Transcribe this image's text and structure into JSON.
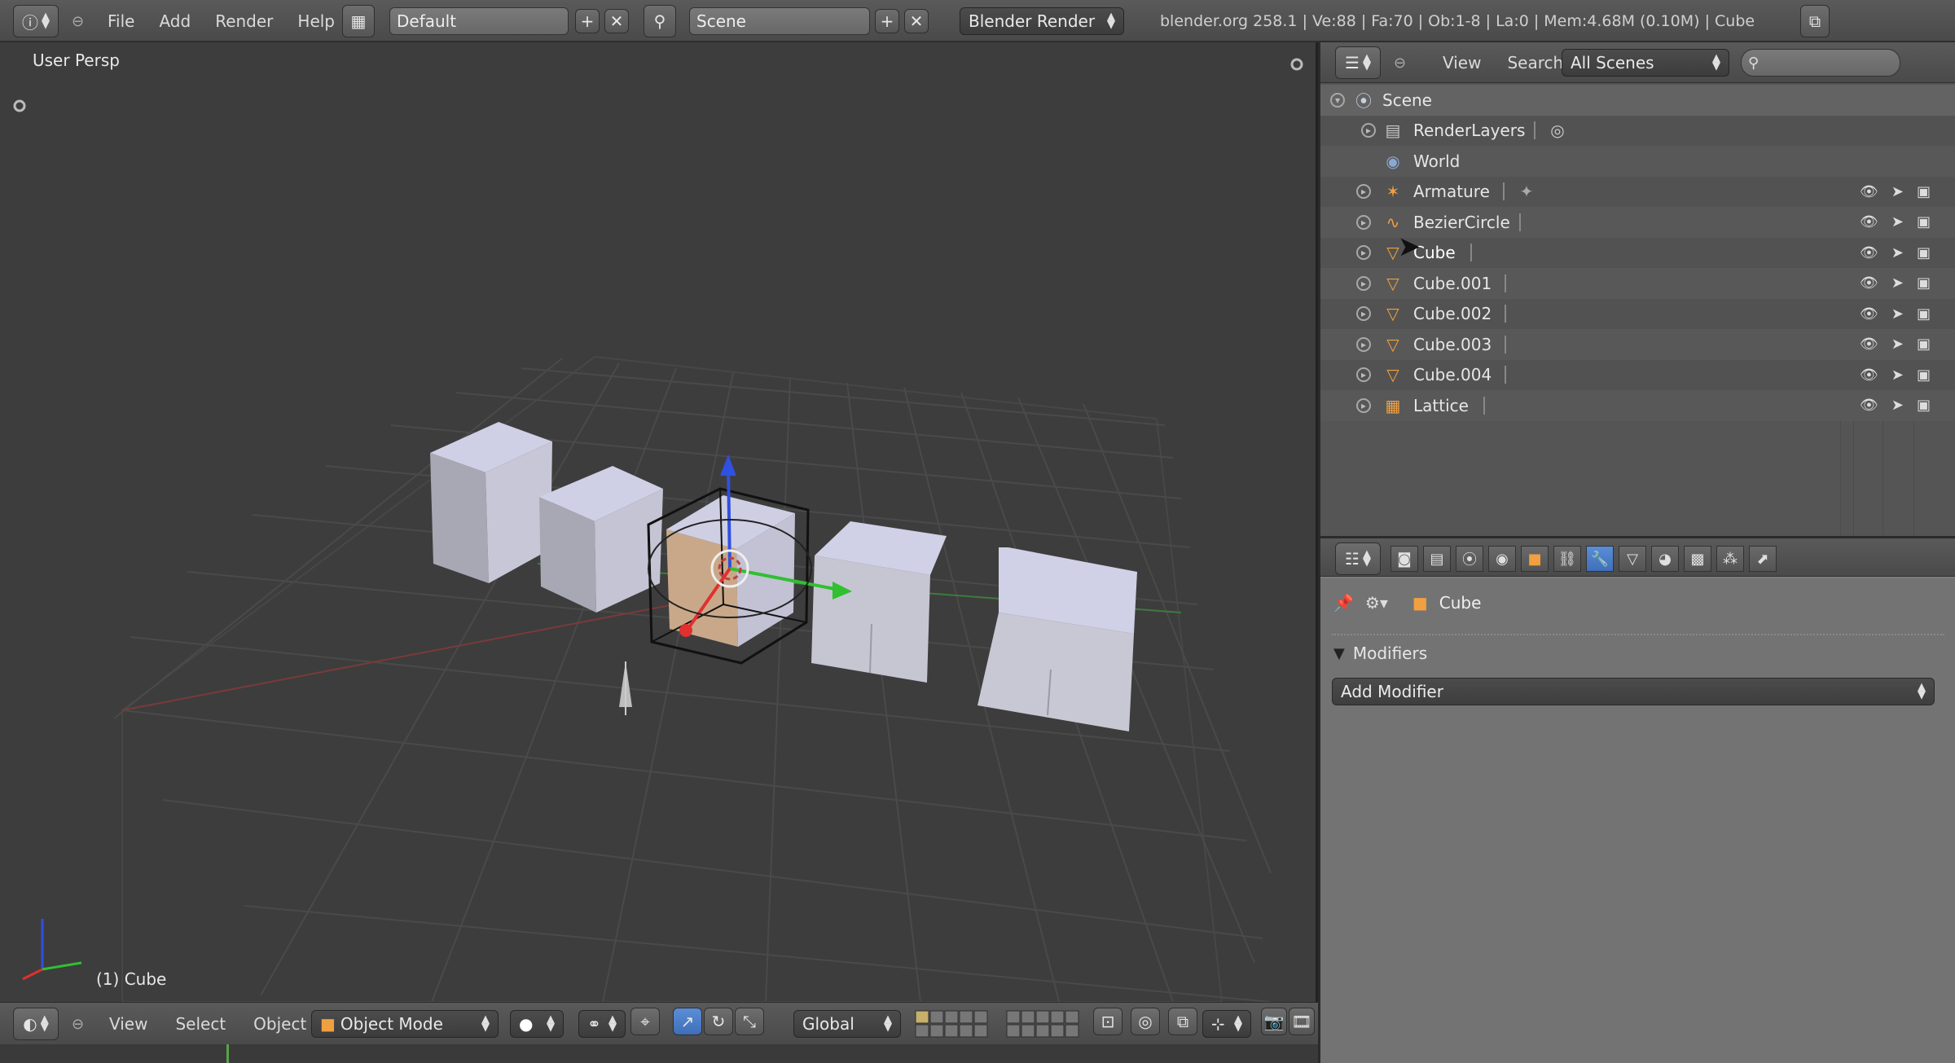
{
  "top_header": {
    "menus": [
      "File",
      "Add",
      "Render",
      "Help"
    ],
    "layout_name": "Default",
    "scene_name": "Scene",
    "render_engine": "Blender Render",
    "stats": "blender.org 258.1 | Ve:88 | Fa:70 | Ob:1-8 | La:0 | Mem:4.68M (0.10M) | Cube"
  },
  "viewport": {
    "title": "User Persp",
    "status": "(1) Cube"
  },
  "viewport_header": {
    "menus": [
      "View",
      "Select",
      "Object"
    ],
    "mode": "Object Mode",
    "orientation": "Global"
  },
  "outliner": {
    "menus": [
      "View",
      "Search"
    ],
    "filter": "All Scenes",
    "search_placeholder": "",
    "items": [
      {
        "label": "Scene",
        "icon": "scene-icon"
      },
      {
        "label": "RenderLayers",
        "icon": "render-layers-icon"
      },
      {
        "label": "World",
        "icon": "world-icon"
      },
      {
        "label": "Armature",
        "icon": "armature-icon"
      },
      {
        "label": "BezierCircle",
        "icon": "curve-icon"
      },
      {
        "label": "Cube",
        "icon": "mesh-icon"
      },
      {
        "label": "Cube.001",
        "icon": "mesh-icon"
      },
      {
        "label": "Cube.002",
        "icon": "mesh-icon"
      },
      {
        "label": "Cube.003",
        "icon": "mesh-icon"
      },
      {
        "label": "Cube.004",
        "icon": "mesh-icon"
      },
      {
        "label": "Lattice",
        "icon": "lattice-icon"
      }
    ]
  },
  "properties": {
    "context_object": "Cube",
    "panel_title": "Modifiers",
    "add_modifier_label": "Add Modifier",
    "active_tab": "modifiers-tab"
  },
  "colors": {
    "accent_blue": "#4a7fcf",
    "object_orange": "#f0a040",
    "axis_x": "#e03030",
    "axis_y": "#30c030",
    "axis_z": "#3050e0"
  }
}
